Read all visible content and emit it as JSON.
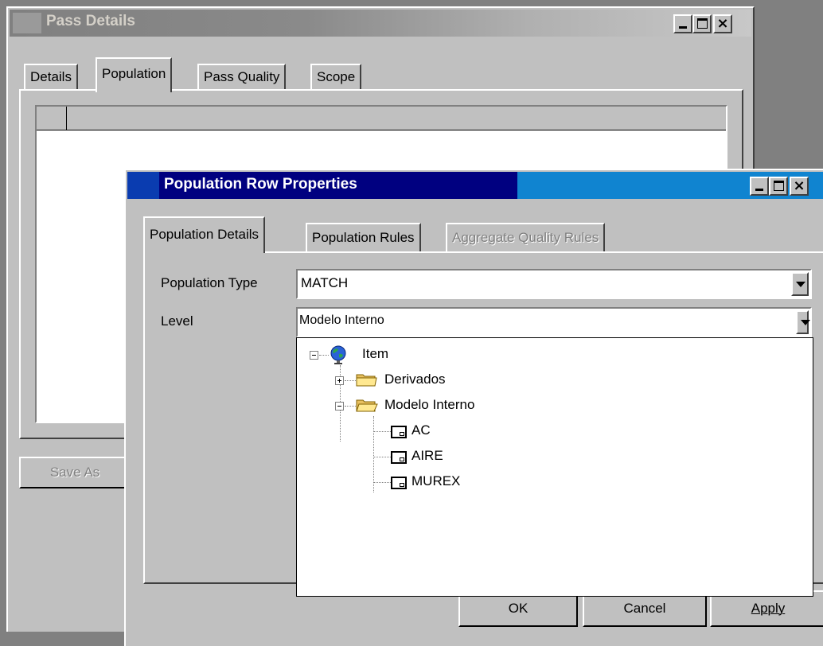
{
  "pass_window": {
    "title": "Pass Details",
    "tabs": [
      "Details",
      "Population",
      "Pass Quality",
      "Scope"
    ],
    "save_as_label": "Save As"
  },
  "dialog": {
    "title": "Population Row Properties",
    "tabs": [
      "Population Details",
      "Population Rules",
      "Aggregate Quality Rules"
    ],
    "population_type_label": "Population Type",
    "population_type_value": "MATCH",
    "level_label": "Level",
    "level_value": "Modelo Interno",
    "tree": {
      "root": "Item",
      "nodes": [
        "Derivados",
        "Modelo Interno"
      ],
      "leaves": [
        "AC",
        "AIRE",
        "MUREX"
      ]
    },
    "buttons": {
      "ok": "OK",
      "cancel": "Cancel",
      "apply": "Apply"
    }
  },
  "colors": {
    "titlebar_inactive": "#808080",
    "titlebar_active": "#000080",
    "titlebar_active_end": "#1084d0",
    "face": "#c0c0c0"
  },
  "icons": [
    "minimize-icon",
    "maximize-icon",
    "close-icon",
    "globe-icon",
    "folder-icon",
    "document-icon"
  ]
}
